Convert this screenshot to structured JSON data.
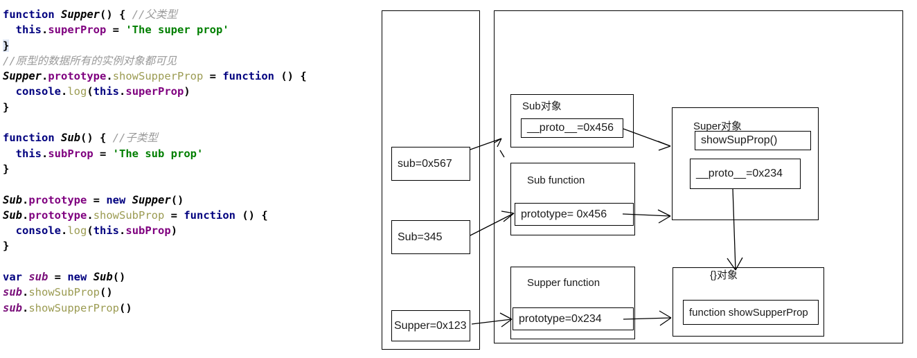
{
  "code": {
    "language": "javascript",
    "lines": [
      [
        {
          "t": "function",
          "c": "kw"
        },
        {
          "t": " ",
          "c": "plain"
        },
        {
          "t": "Supper",
          "c": "id"
        },
        {
          "t": "() { ",
          "c": "pun"
        },
        {
          "t": "//父类型",
          "c": "cmt"
        }
      ],
      [
        {
          "t": "  ",
          "c": "plain"
        },
        {
          "t": "this",
          "c": "kw"
        },
        {
          "t": ".",
          "c": "pun"
        },
        {
          "t": "superProp",
          "c": "prop"
        },
        {
          "t": " = ",
          "c": "pun"
        },
        {
          "t": "'The super prop'",
          "c": "str"
        }
      ],
      [
        {
          "t": "}",
          "c": "brace"
        }
      ],
      [
        {
          "t": "//原型的数据所有的实例对象都可见",
          "c": "cmt"
        }
      ],
      [
        {
          "t": "Supper",
          "c": "id"
        },
        {
          "t": ".",
          "c": "pun"
        },
        {
          "t": "prototype",
          "c": "prop"
        },
        {
          "t": ".",
          "c": "pun"
        },
        {
          "t": "showSupperProp",
          "c": "meth"
        },
        {
          "t": " = ",
          "c": "pun"
        },
        {
          "t": "function",
          "c": "kw"
        },
        {
          "t": " () {",
          "c": "pun"
        }
      ],
      [
        {
          "t": "  ",
          "c": "plain"
        },
        {
          "t": "console",
          "c": "obj"
        },
        {
          "t": ".",
          "c": "pun"
        },
        {
          "t": "log",
          "c": "meth"
        },
        {
          "t": "(",
          "c": "pun"
        },
        {
          "t": "this",
          "c": "kw"
        },
        {
          "t": ".",
          "c": "pun"
        },
        {
          "t": "superProp",
          "c": "prop"
        },
        {
          "t": ")",
          "c": "pun"
        }
      ],
      [
        {
          "t": "}",
          "c": "pun"
        }
      ],
      [
        {
          "t": "",
          "c": "plain"
        }
      ],
      [
        {
          "t": "function",
          "c": "kw"
        },
        {
          "t": " ",
          "c": "plain"
        },
        {
          "t": "Sub",
          "c": "id"
        },
        {
          "t": "() { ",
          "c": "pun"
        },
        {
          "t": "//子类型",
          "c": "cmt"
        }
      ],
      [
        {
          "t": "  ",
          "c": "plain"
        },
        {
          "t": "this",
          "c": "kw"
        },
        {
          "t": ".",
          "c": "pun"
        },
        {
          "t": "subProp",
          "c": "prop"
        },
        {
          "t": " = ",
          "c": "pun"
        },
        {
          "t": "'The sub prop'",
          "c": "str"
        }
      ],
      [
        {
          "t": "}",
          "c": "pun"
        }
      ],
      [
        {
          "t": "",
          "c": "plain"
        }
      ],
      [
        {
          "t": "Sub",
          "c": "id"
        },
        {
          "t": ".",
          "c": "pun"
        },
        {
          "t": "prototype",
          "c": "prop"
        },
        {
          "t": " = ",
          "c": "pun"
        },
        {
          "t": "new",
          "c": "kw"
        },
        {
          "t": " ",
          "c": "plain"
        },
        {
          "t": "Supper",
          "c": "id"
        },
        {
          "t": "()",
          "c": "pun"
        }
      ],
      [
        {
          "t": "Sub",
          "c": "id"
        },
        {
          "t": ".",
          "c": "pun"
        },
        {
          "t": "prototype",
          "c": "prop"
        },
        {
          "t": ".",
          "c": "pun"
        },
        {
          "t": "showSubProp",
          "c": "meth"
        },
        {
          "t": " = ",
          "c": "pun"
        },
        {
          "t": "function",
          "c": "kw"
        },
        {
          "t": " () {",
          "c": "pun"
        }
      ],
      [
        {
          "t": "  ",
          "c": "plain"
        },
        {
          "t": "console",
          "c": "obj"
        },
        {
          "t": ".",
          "c": "pun"
        },
        {
          "t": "log",
          "c": "meth"
        },
        {
          "t": "(",
          "c": "pun"
        },
        {
          "t": "this",
          "c": "kw"
        },
        {
          "t": ".",
          "c": "pun"
        },
        {
          "t": "subProp",
          "c": "prop"
        },
        {
          "t": ")",
          "c": "pun"
        }
      ],
      [
        {
          "t": "}",
          "c": "pun"
        }
      ],
      [
        {
          "t": "",
          "c": "plain"
        }
      ],
      [
        {
          "t": "var",
          "c": "kw"
        },
        {
          "t": " ",
          "c": "plain"
        },
        {
          "t": "sub",
          "c": "var"
        },
        {
          "t": " = ",
          "c": "pun"
        },
        {
          "t": "new",
          "c": "kw"
        },
        {
          "t": " ",
          "c": "plain"
        },
        {
          "t": "Sub",
          "c": "id"
        },
        {
          "t": "()",
          "c": "pun"
        }
      ],
      [
        {
          "t": "sub",
          "c": "var"
        },
        {
          "t": ".",
          "c": "pun"
        },
        {
          "t": "showSubProp",
          "c": "meth"
        },
        {
          "t": "()",
          "c": "pun"
        }
      ],
      [
        {
          "t": "sub",
          "c": "var"
        },
        {
          "t": ".",
          "c": "pun"
        },
        {
          "t": "showSupperProp",
          "c": "meth"
        },
        {
          "t": "()",
          "c": "pun"
        }
      ]
    ]
  },
  "diagram": {
    "stack_container": {
      "label": ""
    },
    "heap_container": {
      "label": ""
    },
    "stack_entries": [
      {
        "name": "sub-pointer",
        "text": "sub=0x567"
      },
      {
        "name": "sub-fn-pointer",
        "text": "Sub=345"
      },
      {
        "name": "supper-fn-pointer",
        "text": "Supper=0x123"
      }
    ],
    "nodes": [
      {
        "name": "sub-object",
        "title": "Sub对象",
        "slots": [
          {
            "text": "__proto__=0x456"
          }
        ]
      },
      {
        "name": "sub-function",
        "title": "Sub function",
        "slots": [
          {
            "text": "prototype= 0x456"
          }
        ]
      },
      {
        "name": "supper-function",
        "title": "Supper function",
        "slots": [
          {
            "text": "prototype=0x234"
          }
        ]
      },
      {
        "name": "super-object",
        "title": "Super对象",
        "slots": [
          {
            "text": "showSupProp()"
          },
          {
            "text": "__proto__=0x234"
          }
        ]
      },
      {
        "name": "empty-object",
        "title": "{}对象",
        "slots": [
          {
            "text": "function showSupperProp"
          }
        ]
      }
    ],
    "colors": {
      "stroke": "#000000",
      "background": "#ffffff",
      "text": "#1a1a1a"
    }
  }
}
